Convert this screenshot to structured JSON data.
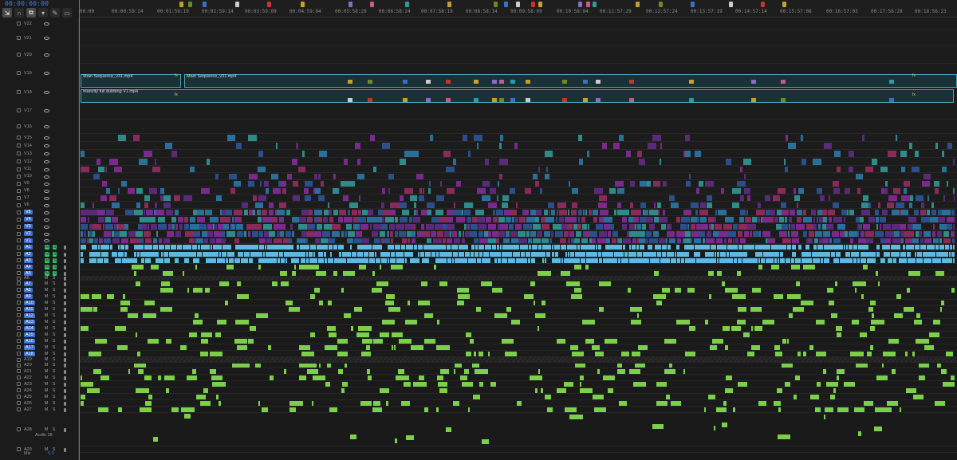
{
  "timecode": "00:00:00:00",
  "tools": [
    "nest-toggle-icon",
    "snap-icon",
    "linked-selection-icon",
    "marker-icon",
    "wrench-icon",
    "captions-icon"
  ],
  "ruler_labels": [
    "00:00",
    "00:00:59:24",
    "00:01:59:19",
    "00:02:59:14",
    "00:03:59:09",
    "00:04:59:04",
    "00:05:58:29",
    "00:06:58:24",
    "00:07:58:19",
    "00:08:58:14",
    "00:09:58:09",
    "00:10:58:04",
    "00:11:57:29",
    "00:12:57:24",
    "00:13:57:19",
    "00:14:57:14",
    "00:15:57:08",
    "00:16:57:03",
    "00:17:56:28",
    "00:18:56:23"
  ],
  "video_tracks": [
    "V22",
    "V21",
    "V20",
    "V19",
    "V18",
    "V17",
    "V16",
    "V15",
    "V14",
    "V13",
    "V12",
    "V11",
    "V10",
    "V9",
    "V8",
    "V7",
    "V6",
    "V5",
    "V4",
    "V3",
    "V2",
    "V1"
  ],
  "audio_tracks": [
    "A1",
    "A2",
    "A3",
    "A4",
    "A5",
    "A6",
    "A7",
    "A8",
    "A9",
    "A10",
    "A11",
    "A12",
    "A13",
    "A14",
    "A15",
    "A16",
    "A17",
    "A18",
    "A19",
    "A20",
    "A21",
    "A22",
    "A23",
    "A24",
    "A25",
    "A26",
    "A27",
    "A28",
    "A29"
  ],
  "audio_track_28_name": "Audio 28",
  "mix": {
    "label": "Mix",
    "value": "0.0"
  },
  "ms_labels": {
    "mute": "M",
    "solo": "S"
  },
  "nested_clips": [
    {
      "label": "Main Sequence_v31.mp4"
    },
    {
      "label": "Main Sequence_v31.mp4"
    },
    {
      "label": "mancity full dubbing V1.mp4"
    }
  ],
  "fx_label": "fx",
  "colors": {
    "playhead": "#3a7ef0",
    "video_clip_purple": "#7a2a8c",
    "video_clip_blue": "#2a6f9a",
    "video_clip_teal": "#2f8a8a",
    "audio_clip_green": "#7ccf4a",
    "nested_border": "#4aa6b8",
    "target_track": "#3b6fd1",
    "solo_on": "#36c46b"
  }
}
